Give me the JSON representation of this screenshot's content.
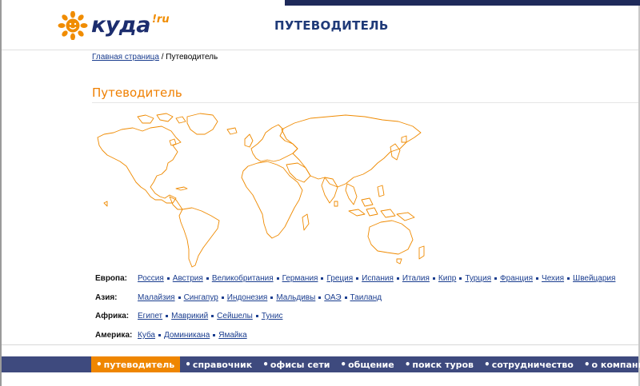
{
  "header": {
    "logo_text": "куда",
    "logo_suffix": "!ru",
    "title": "ПУТЕВОДИТЕЛЬ"
  },
  "breadcrumb": {
    "home_link": "Главная страница",
    "separator": "/",
    "current": "Путеводитель"
  },
  "page_title": "Путеводитель",
  "regions": [
    {
      "label": "Европа:",
      "countries": [
        "Россия",
        "Австрия",
        "Великобритания",
        "Германия",
        "Греция",
        "Испания",
        "Италия",
        "Кипр",
        "Турция",
        "Франция",
        "Чехия",
        "Швейцария"
      ]
    },
    {
      "label": "Азия:",
      "countries": [
        "Малайзия",
        "Сингапур",
        "Индонезия",
        "Мальдивы",
        "ОАЭ",
        "Таиланд"
      ]
    },
    {
      "label": "Африка:",
      "countries": [
        "Египет",
        "Маврикий",
        "Сейшелы",
        "Тунис"
      ]
    },
    {
      "label": "Америка:",
      "countries": [
        "Куба",
        "Доминикана",
        "Ямайка"
      ]
    }
  ],
  "footer_nav": {
    "items": [
      {
        "label": "путеводитель",
        "active": true
      },
      {
        "label": "справочник",
        "active": false
      },
      {
        "label": "офисы сети",
        "active": false
      },
      {
        "label": "общение",
        "active": false
      },
      {
        "label": "поиск туров",
        "active": false
      },
      {
        "label": "сотрудничество",
        "active": false
      },
      {
        "label": "о компании",
        "active": false
      }
    ]
  },
  "colors": {
    "brand_orange": "#ef7f00",
    "brand_navy": "#1c2d6e",
    "link_blue": "#1a3d8f",
    "footer_bar": "#3e4a7e",
    "map_outline": "#ef8a00"
  },
  "icons": {
    "logo": "sun-logo-icon",
    "map": "world-map-icon"
  }
}
